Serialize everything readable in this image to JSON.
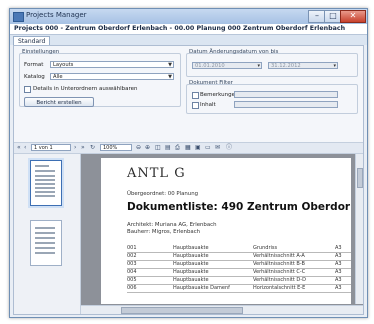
{
  "window": {
    "title": "Projects Manager",
    "min_glyph": "–",
    "max_glyph": "□",
    "close_glyph": "✕"
  },
  "header": {
    "project_line": "Projects 000 - Zentrum Oberdorf Erlenbach - 00.00 Planung 000 Zentrum Oberdorf Erlenbach"
  },
  "tabs": [
    {
      "label": "Standard",
      "active": true
    }
  ],
  "settings": {
    "group_label": "Einstellungen",
    "format_label": "Format",
    "format_value": "Layouts",
    "catalog_label": "Katalog",
    "catalog_value": "Alle",
    "option_label": "Details in Unterordnern auswählbaren",
    "create_button": "Bericht erstellen"
  },
  "date_filter": {
    "group_label": "Datum Änderungsdatum von bis",
    "from_value": "01.01.2010",
    "to_value": "31.12.2012"
  },
  "doc_filter": {
    "group_label": "Dokument Filter",
    "opt1_label": "Bemerkungen",
    "opt2_label": "Inhalt"
  },
  "toolbar": {
    "page_value": "1 von 1",
    "zoom_value": "100%"
  },
  "report": {
    "logo_text": "ANTL G",
    "subtitle": "Übergeordnet: 00 Planung",
    "title": "Dokumentliste: 490 Zentrum Oberdor",
    "line1": "Architekt: Muriana AG, Erlenbach",
    "line2": "Bauherr: Migros, Erlenbach",
    "rows": [
      [
        "001",
        "Hauptbauakte",
        "Grundriss",
        "A3"
      ],
      [
        "002",
        "Hauptbauakte",
        "Verhältnisschnitt A-A",
        "A3"
      ],
      [
        "003",
        "Hauptbauakte",
        "Verhältnisschnitt B-B",
        "A3"
      ],
      [
        "004",
        "Hauptbauakte",
        "Verhältnisschnitt C-C",
        "A3"
      ],
      [
        "005",
        "Hauptbauakte",
        "Verhältnisschnitt D-D",
        "A3"
      ],
      [
        "006",
        "Hauptbauakte Damenf",
        "Horizontalschnitt E-E",
        "A3"
      ]
    ]
  }
}
